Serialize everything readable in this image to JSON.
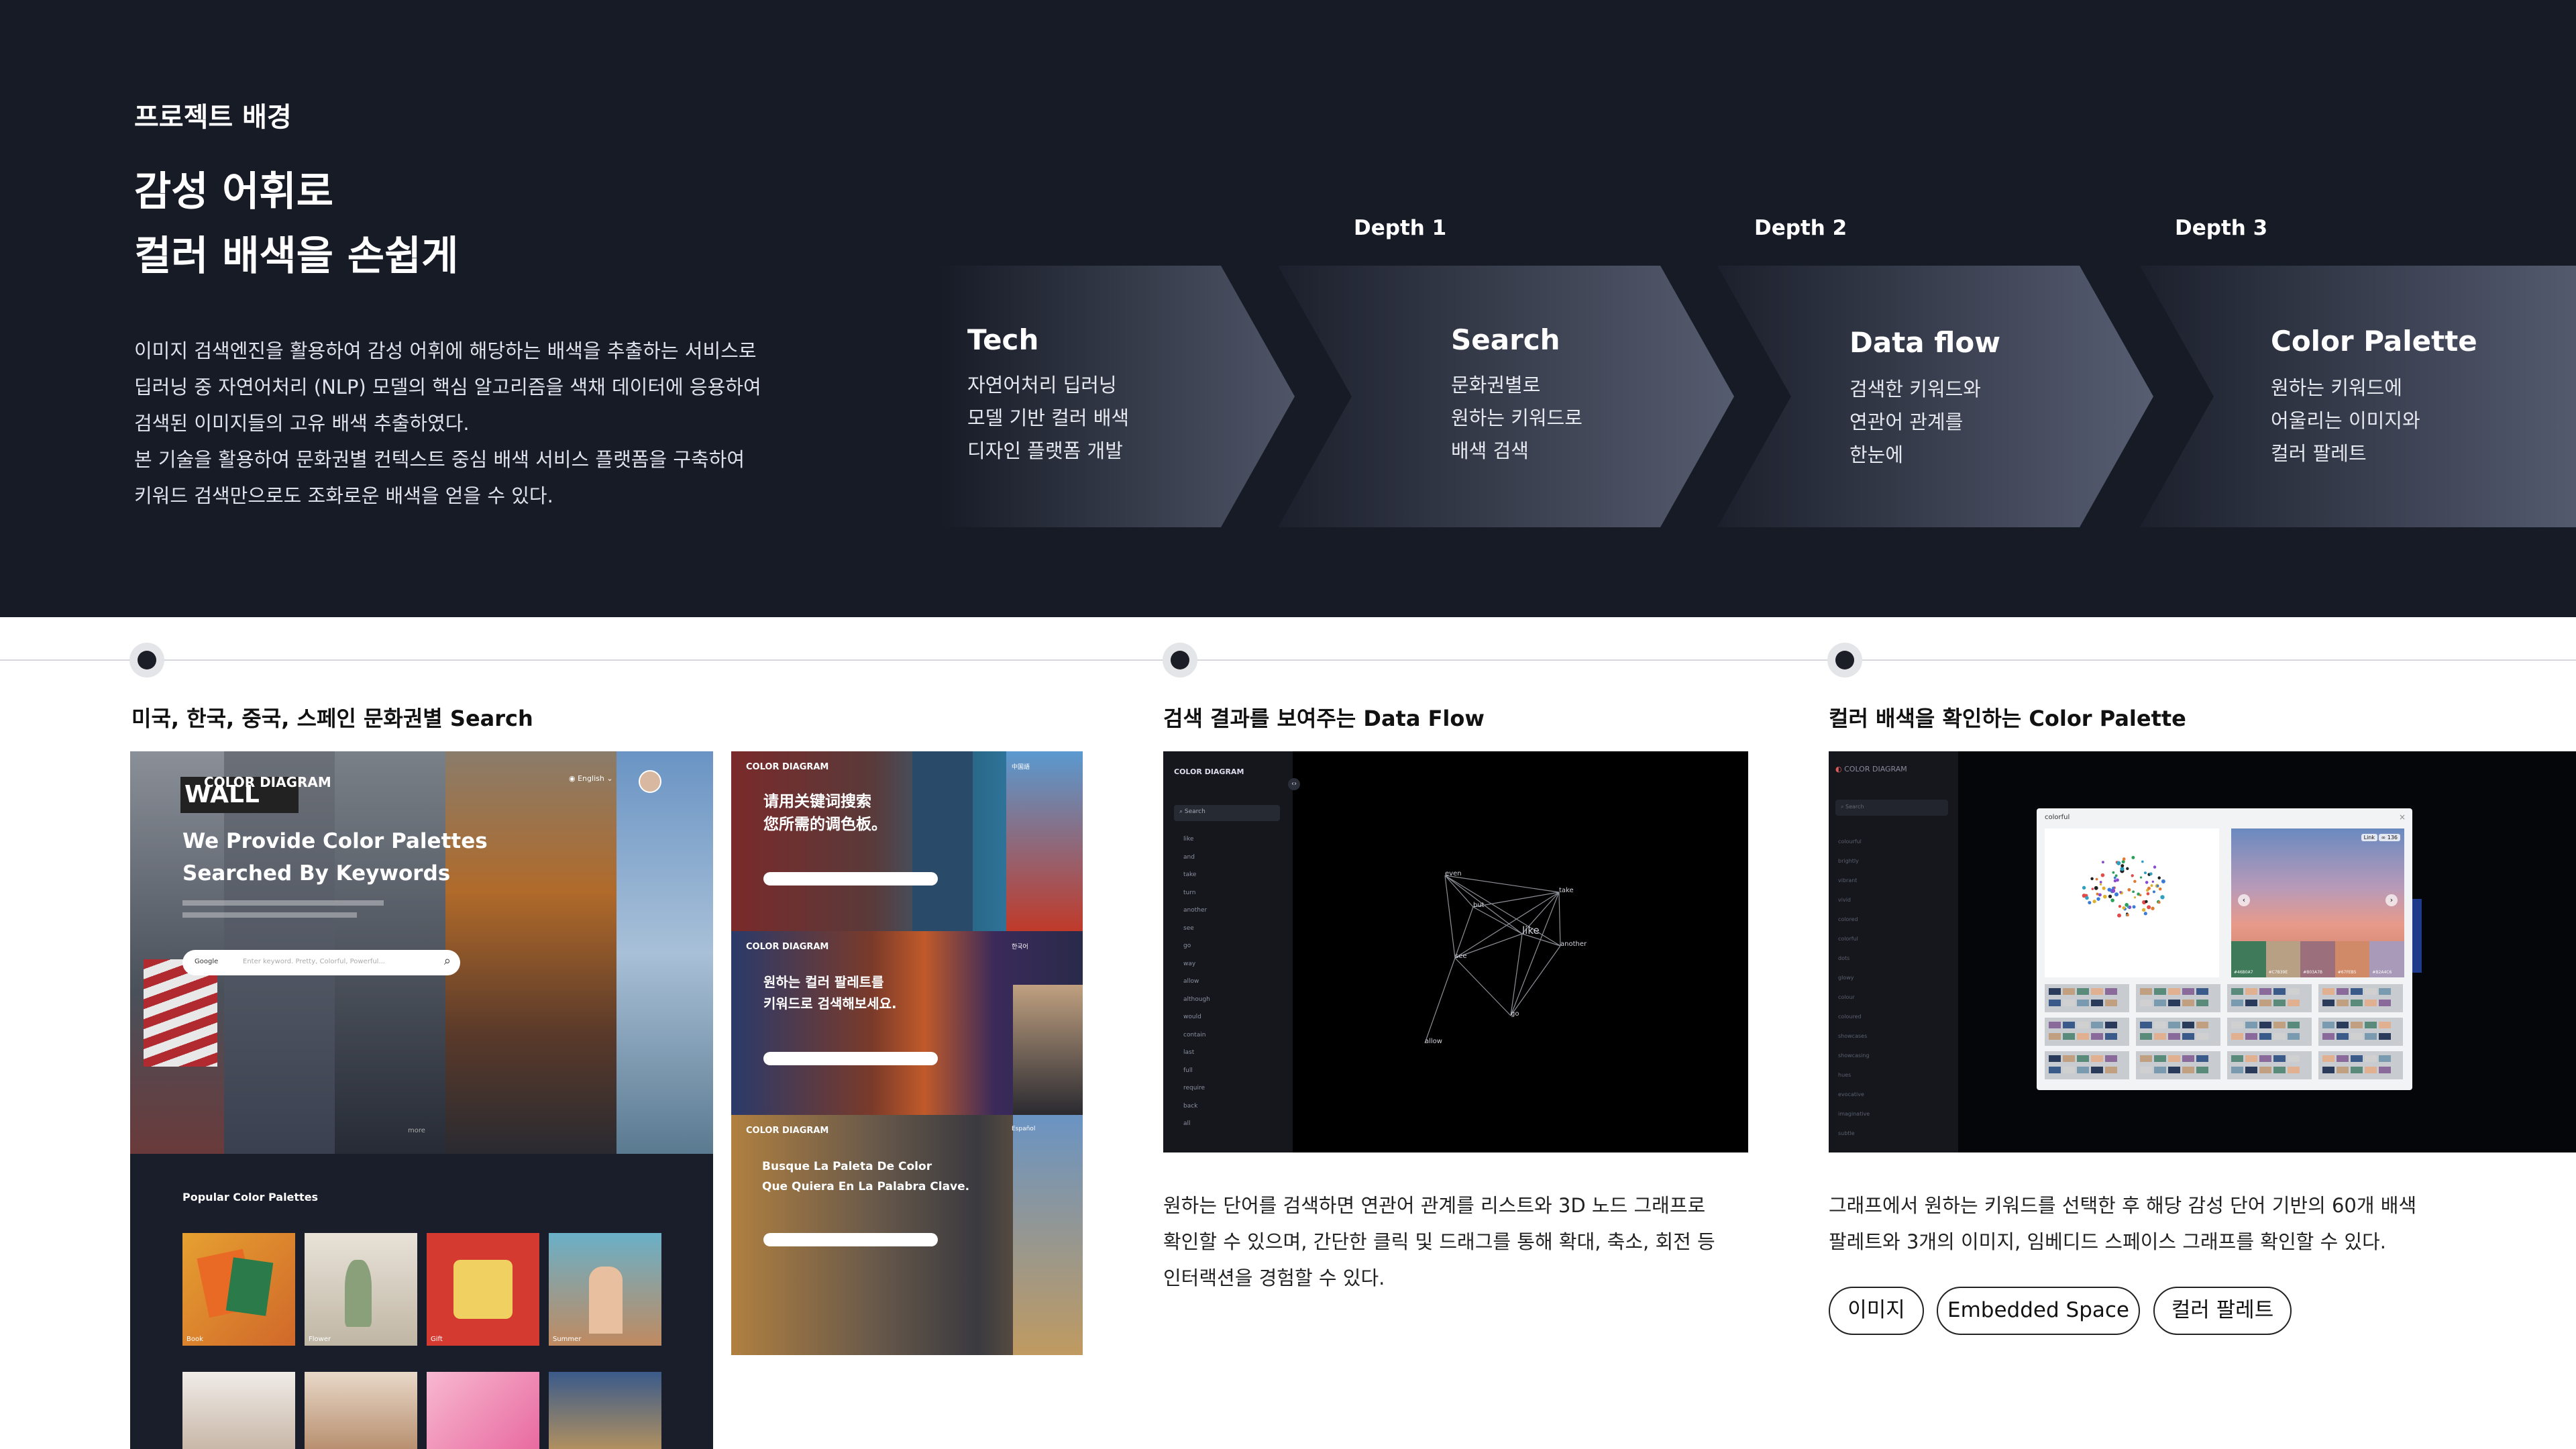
{
  "hero": {
    "section_label": "프로젝트 배경",
    "title_line1": "감성 어휘로",
    "title_line2": "컬러 배색을 손쉽게",
    "description": [
      "이미지 검색엔진을 활용하여 감성 어휘에 해당하는 배색을 추출하는 서비스로",
      "딥러닝 중 자연어처리 (NLP) 모델의 핵심 알고리즘을 색채 데이터에 응용하여",
      "검색된 이미지들의 고유 배색 추출하였다.",
      "본 기술을 활용하여 문화권별 컨텍스트 중심 배색 서비스 플랫폼을 구축하여",
      "키워드 검색만으로도 조화로운 배색을 얻을 수 있다."
    ],
    "depth_labels": [
      "Depth 1",
      "Depth 2",
      "Depth 3"
    ],
    "steps": [
      {
        "title": "Tech",
        "lines": [
          "자연어처리 딥러닝",
          "모델 기반 컬러 배색",
          "디자인 플랫폼 개발"
        ]
      },
      {
        "title": "Search",
        "lines": [
          "문화권별로",
          "원하는 키워드로",
          "배색 검색"
        ]
      },
      {
        "title": "Data flow",
        "lines": [
          "검색한 키워드와",
          "연관어 관계를",
          "한눈에"
        ]
      },
      {
        "title": "Color Palette",
        "lines": [
          "원하는 키워드에",
          "어울리는 이미지와",
          "컬러 팔레트"
        ]
      }
    ]
  },
  "columns": [
    {
      "title": "미국, 한국, 중국, 스페인 문화권별 Search"
    },
    {
      "title": "검색 결과를 보여주는 Data Flow",
      "description": [
        "원하는 단어를 검색하면 연관어 관계를 리스트와 3D 노드 그래프로",
        "확인할 수 있으며, 간단한 클릭 및 드래그를 통해 확대, 축소, 회전 등",
        "인터랙션을 경험할 수 있다."
      ]
    },
    {
      "title": "컬러 배색을 확인하는 Color Palette",
      "description": [
        "그래프에서 원하는 키워드를 선택한 후 해당 감성 단어 기반의 60개 배색",
        "팔레트와 3개의 이미지, 임베디드 스페이스 그래프를 확인할 수 있다."
      ],
      "tags": [
        "이미지",
        "Embedded Space",
        "컬러 팔레트"
      ]
    }
  ],
  "search_shot": {
    "brand": "COLOR DIAGRAM",
    "language": "English",
    "headline1": "We Provide Color Palettes",
    "headline2": "Searched By Keywords",
    "engine": "Google",
    "placeholder": "Enter keyword. Pretty, Colorful, Powerful...",
    "more": "more",
    "popular_title": "Popular Color Palettes",
    "palettes": [
      "Book",
      "Flower",
      "Gift",
      "Summer"
    ],
    "sign": "WALL",
    "cn_headline1": "请用关键词搜索",
    "cn_headline2": "您所需的调色板。",
    "kr_headline1": "원하는 컬러 팔레트를",
    "kr_headline2": "키워드로 검색해보세요.",
    "es_headline1": "Busque La Paleta De Color",
    "es_headline2": "Que Quiera En La Palabra Clave.",
    "lang_cn": "中国語",
    "lang_kr": "한국어",
    "lang_es": "Español"
  },
  "flow_shot": {
    "brand": "COLOR DIAGRAM",
    "search_label": "Search",
    "list": [
      "like",
      "and",
      "take",
      "turn",
      "another",
      "see",
      "go",
      "way",
      "allow",
      "although",
      "would",
      "contain",
      "last",
      "full",
      "require",
      "back",
      "all"
    ],
    "nodes": [
      "even",
      "take",
      "see",
      "like",
      "another",
      "go",
      "allow",
      "but"
    ]
  },
  "palette_shot": {
    "brand": "COLOR DIAGRAM",
    "search_label": "Search",
    "keyword": "colorful",
    "list": [
      "colourful",
      "brightly",
      "vibrant",
      "vivid",
      "colored",
      "colorful",
      "dots",
      "glowy",
      "colour",
      "coloured",
      "showcases",
      "showcasing",
      "hues",
      "evocative",
      "imaginative",
      "subtle"
    ],
    "bg_words": [
      "es",
      "sh",
      "vi"
    ],
    "img_tags": [
      "Link",
      "∞ 136"
    ],
    "swatch_labels": [
      "#46B0A7",
      "#C7B39E",
      "#B03A7B",
      "#67FEB5",
      "#B2A4C6"
    ]
  }
}
